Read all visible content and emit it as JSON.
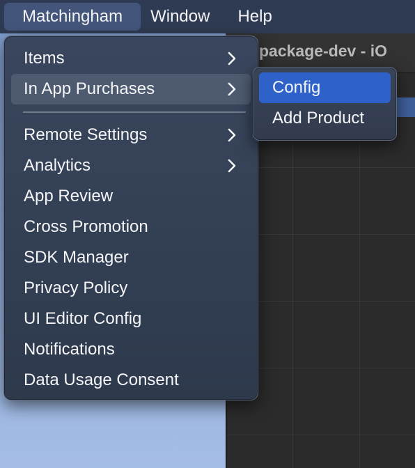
{
  "background_window": {
    "title": "package-dev - iO"
  },
  "menubar": {
    "items": [
      {
        "label": "Matchingham",
        "active": true
      },
      {
        "label": "Window"
      },
      {
        "label": "Help"
      }
    ]
  },
  "dropdown": {
    "items": [
      {
        "label": "Items",
        "submenu_icon": "chevron-right-icon"
      },
      {
        "label": "In App Purchases",
        "submenu_icon": "chevron-right-icon",
        "highlighted": true
      },
      {
        "label": "Remote Settings",
        "submenu_icon": "chevron-right-icon"
      },
      {
        "label": "Analytics",
        "submenu_icon": "chevron-right-icon"
      },
      {
        "label": "App Review"
      },
      {
        "label": "Cross Promotion"
      },
      {
        "label": "SDK Manager"
      },
      {
        "label": "Privacy Policy"
      },
      {
        "label": "UI Editor Config"
      },
      {
        "label": "Notifications"
      },
      {
        "label": "Data Usage Consent"
      }
    ]
  },
  "submenu": {
    "items": [
      {
        "label": "Config",
        "selected": true
      },
      {
        "label": "Add Product"
      }
    ]
  },
  "colors": {
    "menubar_bg": "#2f3b52",
    "menu_bg": "#354156",
    "highlight": "#4d5a70",
    "selection": "#2e62c9"
  }
}
